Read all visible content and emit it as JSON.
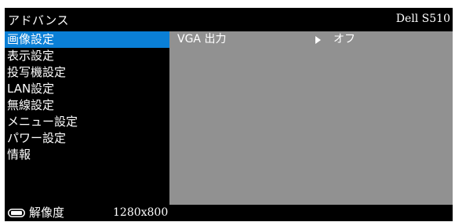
{
  "header": {
    "title": "アドバンス",
    "model": "Dell S510"
  },
  "sidebar": {
    "selected_index": 0,
    "items": [
      {
        "label": "画像設定"
      },
      {
        "label": "表示設定"
      },
      {
        "label": "投写機設定"
      },
      {
        "label": "LAN設定"
      },
      {
        "label": "無線設定"
      },
      {
        "label": "メニュー設定"
      },
      {
        "label": "パワー設定"
      },
      {
        "label": "情報"
      }
    ]
  },
  "content": {
    "rows": [
      {
        "label": "VGA 出力",
        "value": "オフ",
        "icon": "triangle-right-icon"
      }
    ]
  },
  "footer": {
    "icon": "resolution-icon",
    "label": "解像度",
    "value": "1280x800"
  },
  "colors": {
    "background": "#000000",
    "highlight": "#0a7fd6",
    "panel": "#919191",
    "text": "#ffffff"
  }
}
